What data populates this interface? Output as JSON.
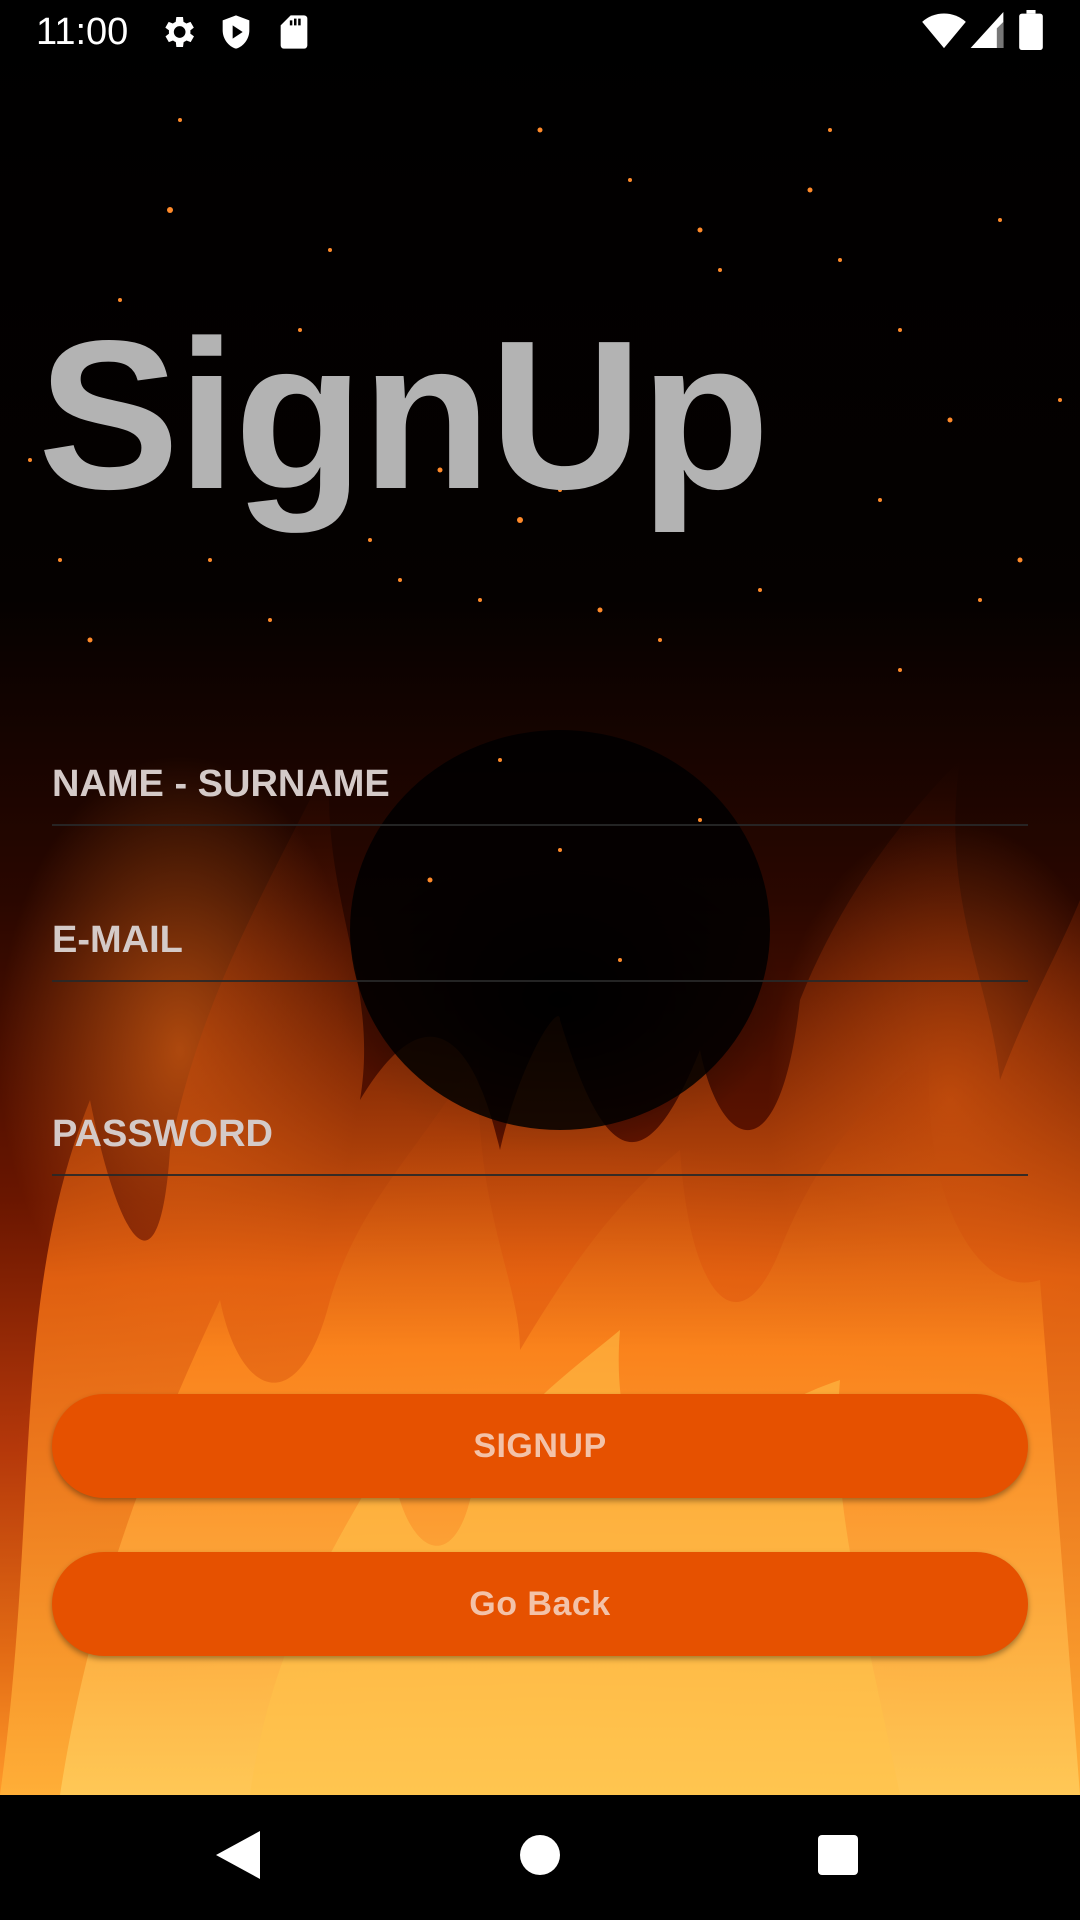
{
  "status_bar": {
    "time": "11:00",
    "left_icons": [
      "settings-icon",
      "shield-icon",
      "sd-card-icon"
    ],
    "right_icons": [
      "wifi-icon",
      "cellular-signal-icon",
      "battery-icon"
    ]
  },
  "title": "SignUp",
  "form": {
    "name_placeholder": "NAME - SURNAME",
    "email_placeholder": "E-MAIL",
    "password_placeholder": "PASSWORD"
  },
  "buttons": {
    "signup_label": "SIGNUP",
    "go_back_label": "Go Back"
  },
  "nav_bar": {
    "icons": [
      "back-icon",
      "home-icon",
      "recents-icon"
    ]
  },
  "colors": {
    "button": "#e65100",
    "button_text": "#f3c2a8",
    "title": "#b3b3b3",
    "placeholder": "#d4cac8",
    "background": "#000000"
  }
}
